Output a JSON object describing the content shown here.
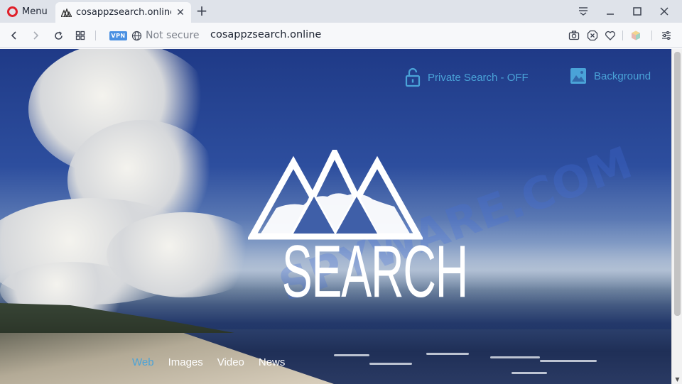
{
  "browser": {
    "menu_label": "Menu",
    "tab_title": "cosappzsearch.online",
    "new_tab": "+",
    "vpn_label": "VPN",
    "security_text": "Not secure",
    "url": "cosappzsearch.online"
  },
  "page": {
    "private_search_label": "Private Search -  OFF",
    "background_label": "Background",
    "logo_text": "SEARCH",
    "watermark": "SPYWARE.COM",
    "search_tabs": [
      "Web",
      "Images",
      "Video",
      "News"
    ],
    "active_tab": "Web"
  },
  "colors": {
    "accent": "#4aa3d8",
    "opera_red": "#e0202a",
    "vpn_blue": "#4a90e2"
  },
  "icons": [
    "opera-logo-icon",
    "mountain-favicon-icon",
    "close-icon",
    "plus-icon",
    "tab-menu-icon",
    "minimize-icon",
    "maximize-icon",
    "close-window-icon",
    "back-icon",
    "forward-icon",
    "reload-icon",
    "speed-dial-icon",
    "globe-icon",
    "camera-icon",
    "adblock-icon",
    "heart-icon",
    "extension-cube-icon",
    "settings-sliders-icon",
    "lock-icon",
    "image-icon"
  ]
}
